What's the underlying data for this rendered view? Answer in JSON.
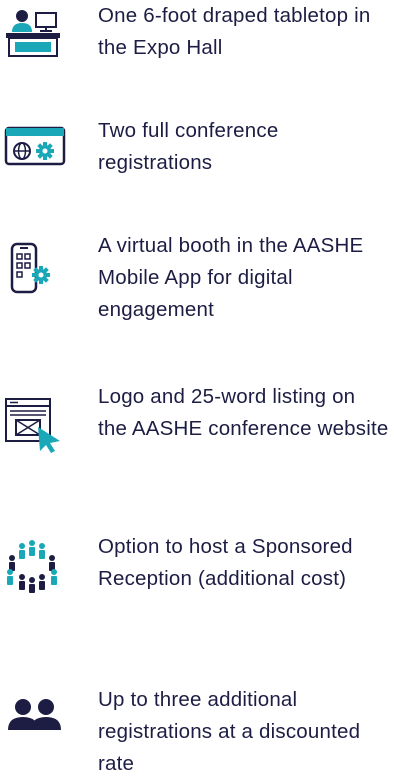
{
  "benefits": [
    {
      "icon": "exhibit-booth-icon",
      "text": "One 6-foot draped tabletop in the Expo Hall"
    },
    {
      "icon": "online-registration-icon",
      "text": "Two full conference registrations"
    },
    {
      "icon": "mobile-app-settings-icon",
      "text": "A virtual booth in the AASHE Mobile App for digital engagement"
    },
    {
      "icon": "website-listing-icon",
      "text": "Logo and 25-word listing on the AASHE conference website"
    },
    {
      "icon": "crowd-circle-icon",
      "text": "Option to host a Sponsored Reception (additional cost)"
    },
    {
      "icon": "user-group-icon",
      "text": "Up to three additional registrations at a discounted rate"
    }
  ],
  "colors": {
    "text": "#1d1d44",
    "navy": "#1d1d44",
    "teal": "#1aa8b8"
  }
}
